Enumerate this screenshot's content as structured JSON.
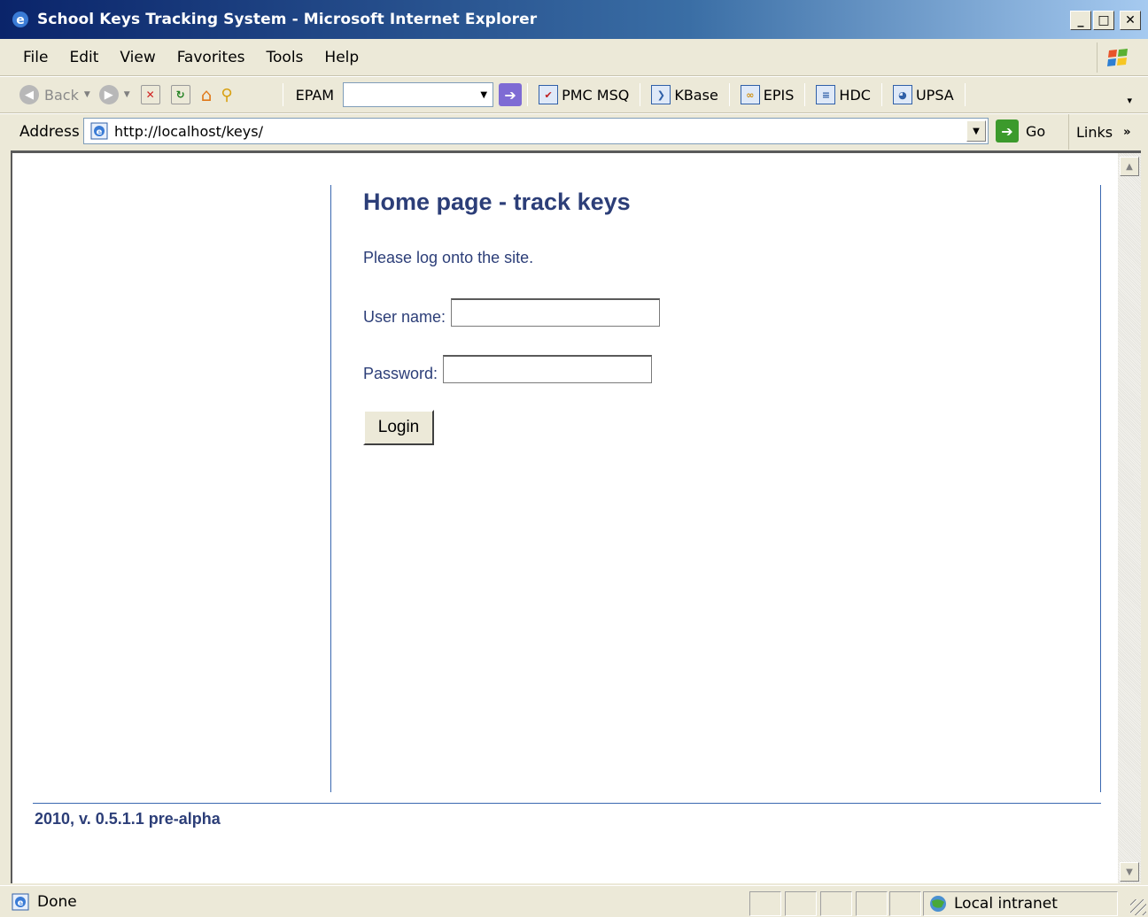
{
  "window": {
    "title": "School Keys Tracking System - Microsoft Internet Explorer",
    "minimize": "_",
    "maximize": "□",
    "close": "✕"
  },
  "menu": [
    "File",
    "Edit",
    "View",
    "Favorites",
    "Tools",
    "Help"
  ],
  "toolbar": {
    "back_label": "Back",
    "epam_label": "EPAM",
    "links": [
      "PMC MSQ",
      "KBase",
      "EPIS",
      "HDC",
      "UPSA"
    ]
  },
  "address": {
    "label": "Address",
    "url": "http://localhost/keys/",
    "go_label": "Go",
    "links_label": "Links"
  },
  "page": {
    "title": "Home page - track keys",
    "prompt": "Please log onto the site.",
    "username_label": "User name:",
    "password_label": "Password:",
    "login_button": "Login",
    "footer": "2010, v. 0.5.1.1 pre-alpha"
  },
  "status": {
    "text": "Done",
    "zone": "Local intranet"
  },
  "colors": {
    "accent": "#2c3e78",
    "rule": "#3a68b0"
  }
}
